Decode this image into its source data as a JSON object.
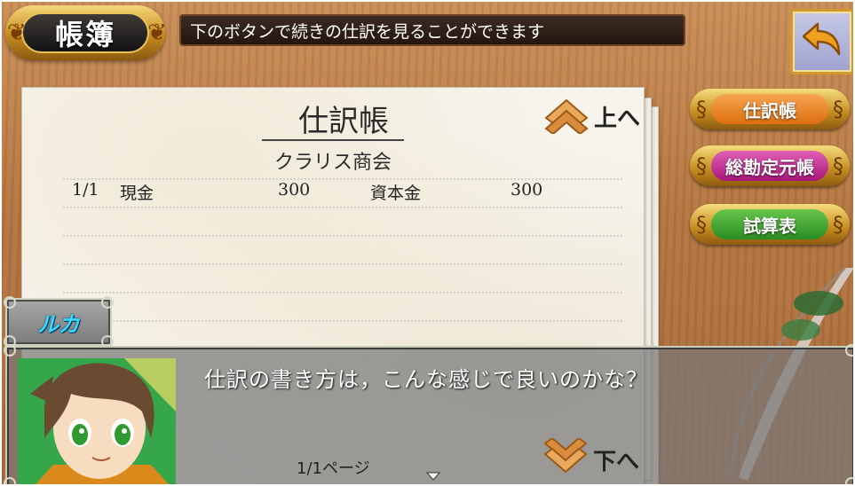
{
  "header": {
    "screen_title": "帳簿",
    "hint": "下のボタンで続きの仕訳を見ることができます",
    "back_icon": "back-arrow-icon"
  },
  "journal": {
    "title": "仕訳帳",
    "company": "クラリス商会",
    "entries": [
      {
        "date": "1/1",
        "debit_account": "現金",
        "debit_amount": "300",
        "credit_account": "資本金",
        "credit_amount": "300"
      }
    ],
    "page_up_label": "上へ",
    "page_down_label": "下へ"
  },
  "menu": {
    "items": [
      {
        "label": "仕訳帳",
        "color": "#e7831b"
      },
      {
        "label": "総勘定元帳",
        "color": "#c0238e"
      },
      {
        "label": "試算表",
        "color": "#35a32b"
      }
    ]
  },
  "dialogue": {
    "speaker": "ルカ",
    "text": "仕訳の書き方は，こんな感じで良いのかな？",
    "page_indicator": "1/1ページ"
  }
}
